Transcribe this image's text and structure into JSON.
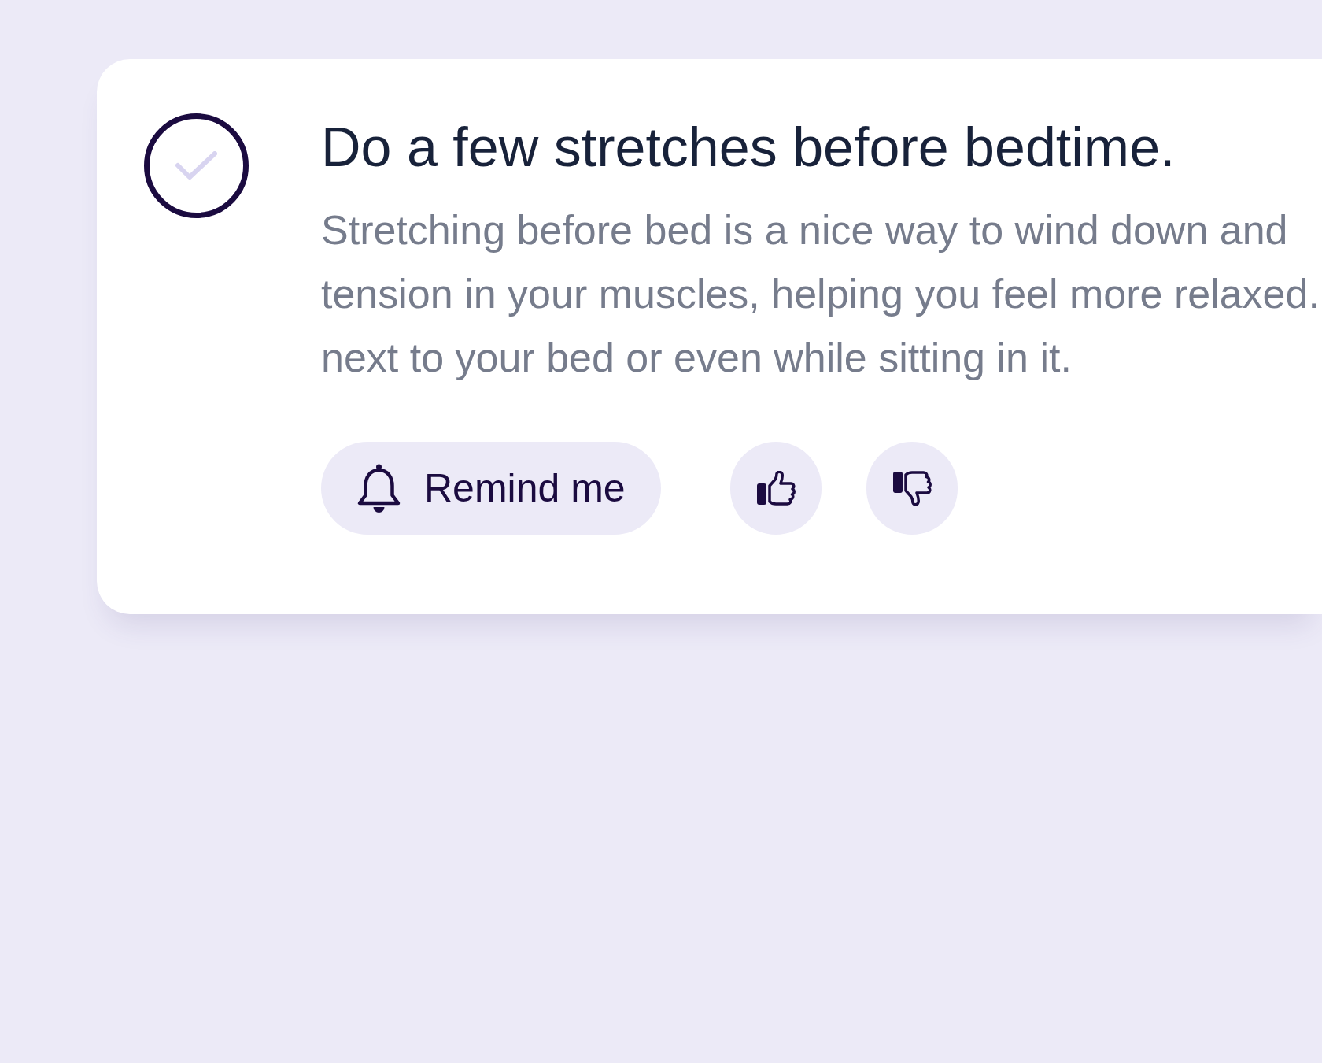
{
  "task": {
    "completed": false,
    "title": "Do a few stretches before bedtime.",
    "description_lines": [
      "Stretching before bed is a nice way to wind down and",
      "tension in your muscles, helping you feel more relaxed.",
      "next to your bed or even while sitting in it."
    ]
  },
  "actions": [
    {
      "kind": "reminder",
      "label": "Remind me"
    },
    {
      "kind": "thumbs_up"
    },
    {
      "kind": "thumbs_down"
    }
  ]
}
